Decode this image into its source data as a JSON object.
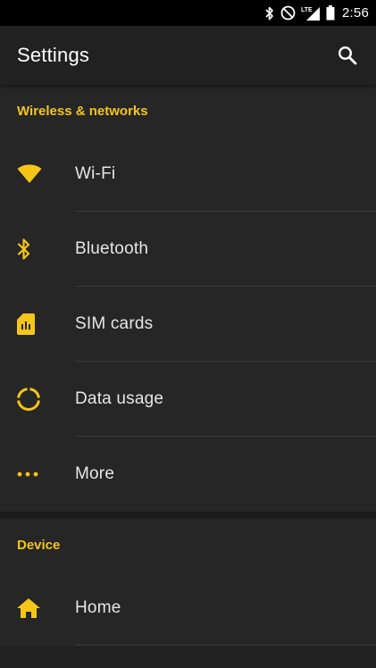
{
  "status_bar": {
    "time": "2:56",
    "network": "LTE",
    "icons": [
      "bluetooth-icon",
      "do-not-disturb-icon",
      "lte-signal-icon",
      "battery-icon"
    ]
  },
  "app_bar": {
    "title": "Settings",
    "search_icon": "search-icon"
  },
  "colors": {
    "accent": "#f5c518",
    "background": "#212121",
    "text": "#e6e6e6"
  },
  "sections": [
    {
      "header": "Wireless & networks",
      "items": [
        {
          "label": "Wi-Fi",
          "icon": "wifi-icon"
        },
        {
          "label": "Bluetooth",
          "icon": "bluetooth-icon"
        },
        {
          "label": "SIM cards",
          "icon": "sim-card-icon"
        },
        {
          "label": "Data usage",
          "icon": "data-usage-icon"
        },
        {
          "label": "More",
          "icon": "more-horiz-icon"
        }
      ]
    },
    {
      "header": "Device",
      "items": [
        {
          "label": "Home",
          "icon": "home-icon"
        }
      ]
    }
  ]
}
